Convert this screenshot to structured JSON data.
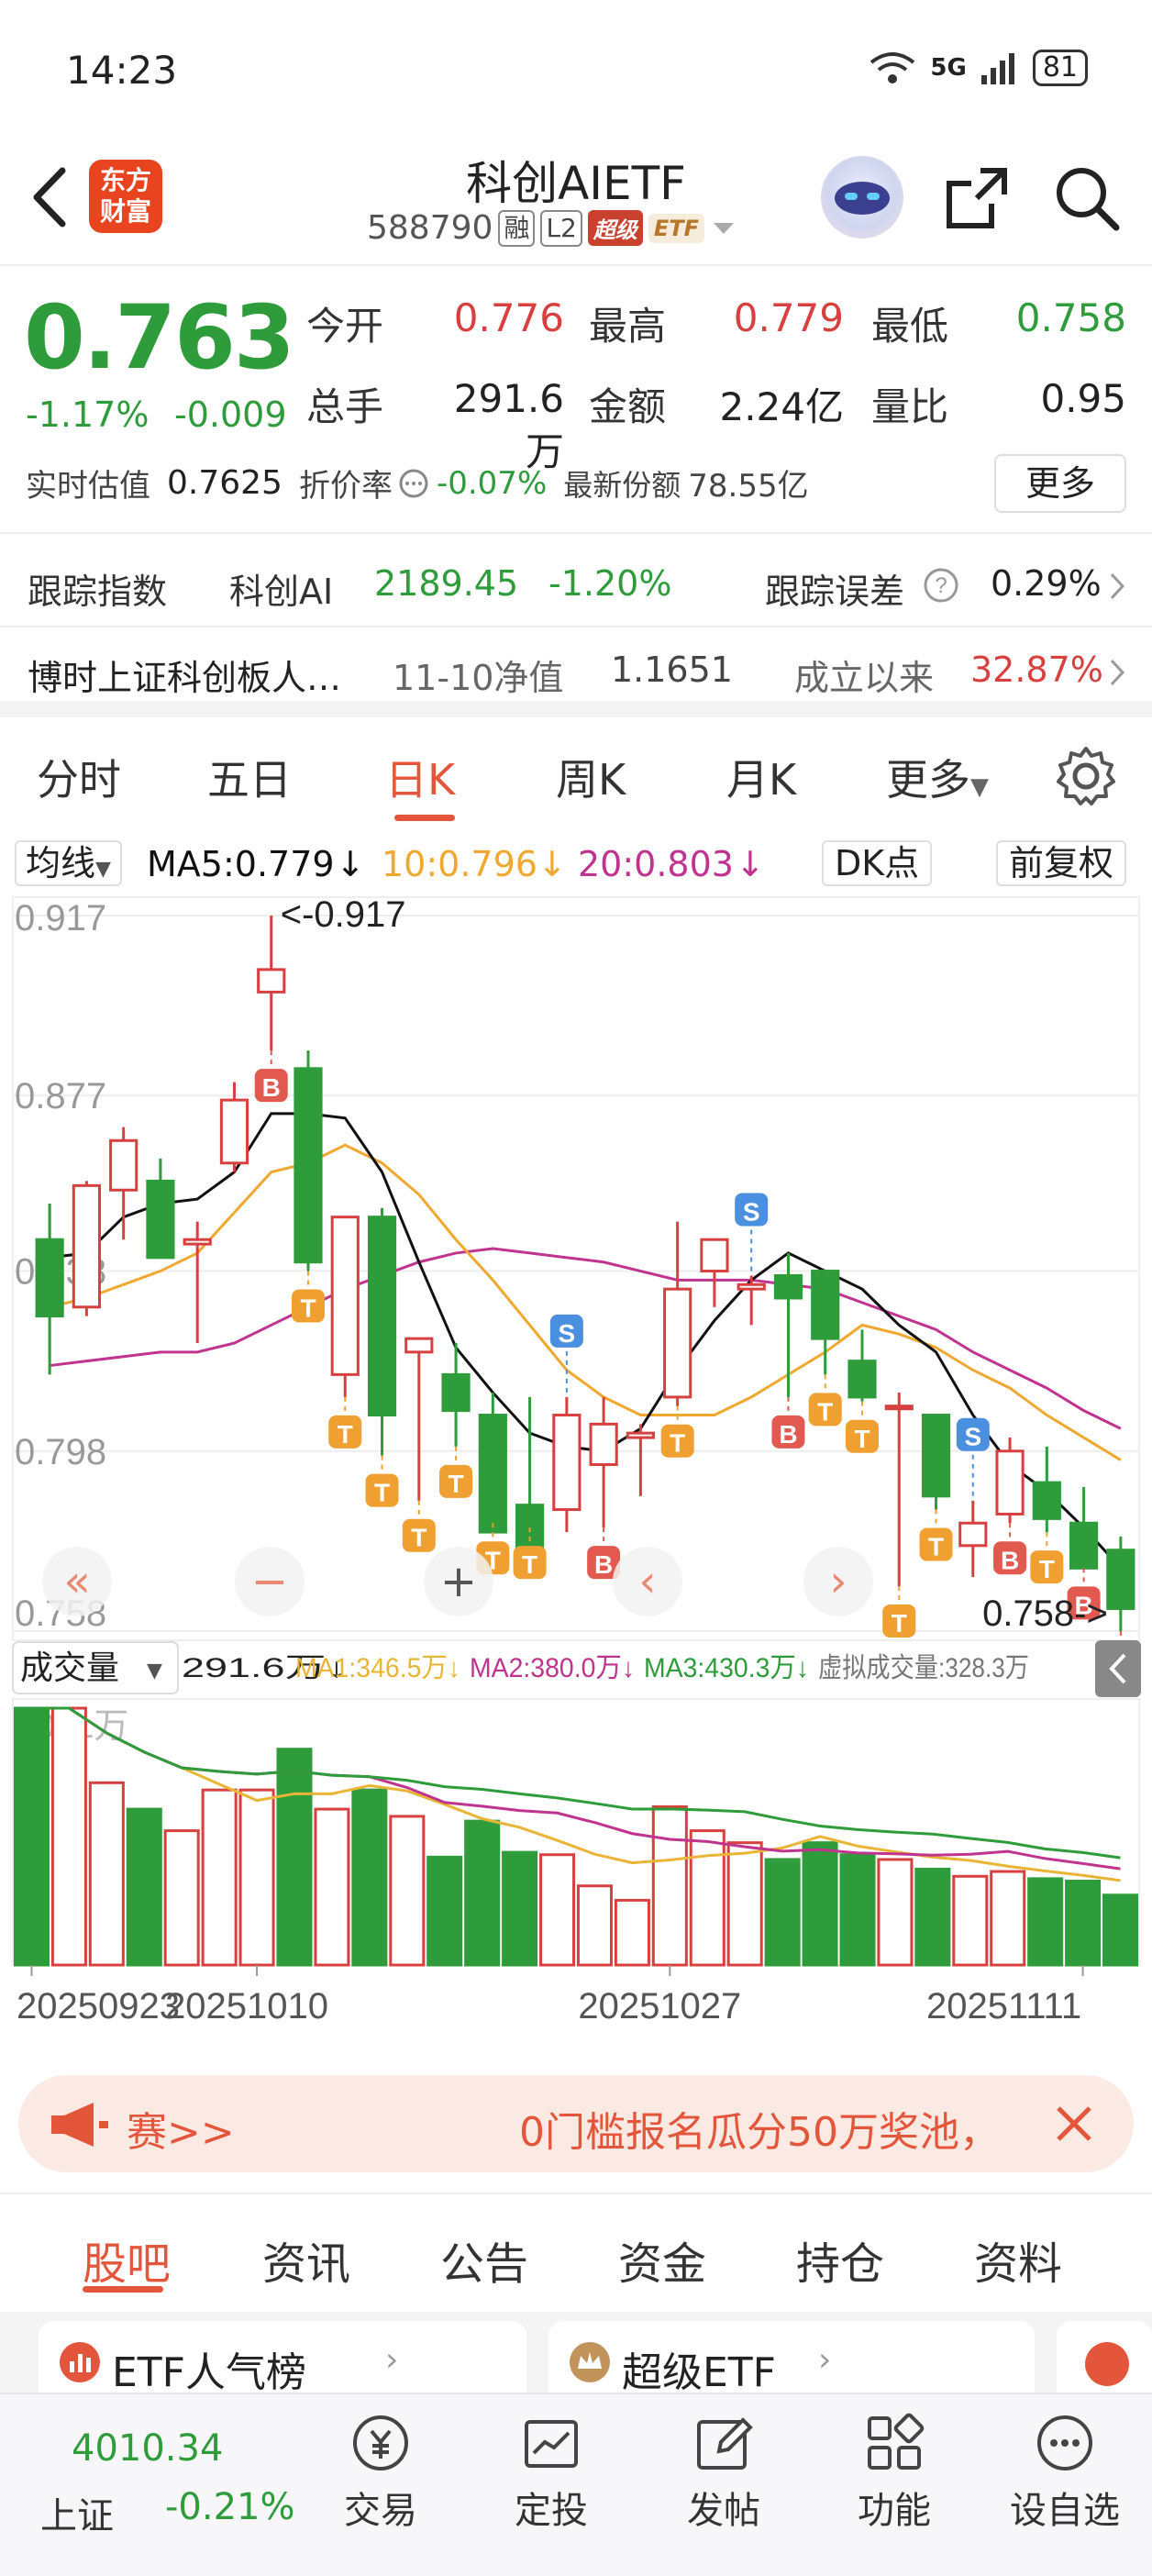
{
  "status": {
    "time": "14:23",
    "network": "5G",
    "battery": "81"
  },
  "header": {
    "title": "科创AIETF",
    "code": "588790",
    "tag_margin": "融",
    "tag_level": "L2",
    "tag_super": "超级",
    "tag_etf": "ETF",
    "logo_line1": "东方",
    "logo_line2": "财富"
  },
  "quote": {
    "price": "0.763",
    "change_pct": "-1.17%",
    "change_val": "-0.009",
    "open_label": "今开",
    "open": "0.776",
    "high_label": "最高",
    "high": "0.779",
    "low_label": "最低",
    "low": "0.758",
    "volume_label": "总手",
    "volume": "291.6万",
    "amount_label": "金额",
    "amount": "2.24亿",
    "ratio_label": "量比",
    "ratio": "0.95",
    "est_label": "实时估值",
    "est": "0.7625",
    "premium_label": "折价率",
    "premium": "-0.07%",
    "shares_label": "最新份额",
    "shares": "78.55亿",
    "more_button": "更多"
  },
  "tracking": {
    "label": "跟踪指数",
    "index_name": "科创AI",
    "index_value": "2189.45",
    "index_change": "-1.20%",
    "error_label": "跟踪误差",
    "error": "0.29%"
  },
  "fund": {
    "name": "博时上证科创板人…",
    "nav_label": "11-10净值",
    "nav": "1.1651",
    "since_label": "成立以来",
    "since": "32.87%"
  },
  "period_tabs": [
    "分时",
    "五日",
    "日K",
    "周K",
    "月K",
    "更多"
  ],
  "ma": {
    "selector": "均线",
    "ma5": "MA5:0.779",
    "ma10": "10:0.796",
    "ma20": "20:0.803",
    "dk": "DK点",
    "adjust": "前复权"
  },
  "colors": {
    "up": "#d8403f",
    "down": "#2e9c3a",
    "ma5": "#111111",
    "ma10": "#f0a830",
    "ma20": "#c0348f",
    "accent": "#e4563b"
  },
  "chart_data": [
    {
      "type": "candlestick",
      "y_axis_ticks": [
        "0.917",
        "0.877",
        "0.838",
        "0.798",
        "0.758"
      ],
      "ylim": [
        0.758,
        0.917
      ],
      "max_marker": "<-0.917",
      "min_marker": "0.758->",
      "candles": [
        {
          "o": 0.845,
          "h": 0.853,
          "l": 0.815,
          "c": 0.828
        },
        {
          "o": 0.83,
          "h": 0.858,
          "l": 0.828,
          "c": 0.857
        },
        {
          "o": 0.856,
          "h": 0.87,
          "l": 0.845,
          "c": 0.867
        },
        {
          "o": 0.858,
          "h": 0.863,
          "l": 0.843,
          "c": 0.841
        },
        {
          "o": 0.844,
          "h": 0.849,
          "l": 0.822,
          "c": 0.845
        },
        {
          "o": 0.862,
          "h": 0.88,
          "l": 0.86,
          "c": 0.876
        },
        {
          "o": 0.9,
          "h": 0.917,
          "l": 0.887,
          "c": 0.905
        },
        {
          "o": 0.883,
          "h": 0.887,
          "l": 0.838,
          "c": 0.84
        },
        {
          "o": 0.815,
          "h": 0.849,
          "l": 0.81,
          "c": 0.85
        },
        {
          "o": 0.85,
          "h": 0.852,
          "l": 0.797,
          "c": 0.806
        },
        {
          "o": 0.82,
          "h": 0.823,
          "l": 0.787,
          "c": 0.823
        },
        {
          "o": 0.815,
          "h": 0.822,
          "l": 0.799,
          "c": 0.807
        },
        {
          "o": 0.806,
          "h": 0.811,
          "l": 0.782,
          "c": 0.78
        },
        {
          "o": 0.786,
          "h": 0.81,
          "l": 0.781,
          "c": 0.776
        },
        {
          "o": 0.785,
          "h": 0.81,
          "l": 0.78,
          "c": 0.806
        },
        {
          "o": 0.795,
          "h": 0.81,
          "l": 0.781,
          "c": 0.804
        },
        {
          "o": 0.801,
          "h": 0.804,
          "l": 0.788,
          "c": 0.802
        },
        {
          "o": 0.81,
          "h": 0.849,
          "l": 0.808,
          "c": 0.834
        },
        {
          "o": 0.838,
          "h": 0.84,
          "l": 0.83,
          "c": 0.845
        },
        {
          "o": 0.834,
          "h": 0.837,
          "l": 0.826,
          "c": 0.835
        },
        {
          "o": 0.837,
          "h": 0.842,
          "l": 0.81,
          "c": 0.832
        },
        {
          "o": 0.838,
          "h": 0.838,
          "l": 0.815,
          "c": 0.823
        },
        {
          "o": 0.818,
          "h": 0.825,
          "l": 0.809,
          "c": 0.81
        },
        {
          "o": 0.808,
          "h": 0.811,
          "l": 0.768,
          "c": 0.808
        },
        {
          "o": 0.806,
          "h": 0.806,
          "l": 0.785,
          "c": 0.788
        },
        {
          "o": 0.777,
          "h": 0.787,
          "l": 0.77,
          "c": 0.782
        },
        {
          "o": 0.784,
          "h": 0.801,
          "l": 0.782,
          "c": 0.798
        },
        {
          "o": 0.791,
          "h": 0.799,
          "l": 0.78,
          "c": 0.783
        },
        {
          "o": 0.782,
          "h": 0.79,
          "l": 0.772,
          "c": 0.772
        },
        {
          "o": 0.776,
          "h": 0.779,
          "l": 0.758,
          "c": 0.763
        }
      ],
      "ma5_line": [
        0.841,
        0.842,
        0.85,
        0.853,
        0.854,
        0.86,
        0.873,
        0.873,
        0.872,
        0.86,
        0.84,
        0.821,
        0.811,
        0.802,
        0.799,
        0.798,
        0.803,
        0.816,
        0.827,
        0.836,
        0.842,
        0.838,
        0.834,
        0.826,
        0.82,
        0.806,
        0.795,
        0.789,
        0.781,
        0.772
      ],
      "ma10_line": [
        0.83,
        0.832,
        0.835,
        0.838,
        0.842,
        0.851,
        0.86,
        0.862,
        0.866,
        0.862,
        0.855,
        0.845,
        0.836,
        0.826,
        0.816,
        0.81,
        0.806,
        0.806,
        0.806,
        0.81,
        0.815,
        0.82,
        0.826,
        0.824,
        0.821,
        0.816,
        0.812,
        0.806,
        0.801,
        0.796
      ],
      "ma20_line": [
        0.817,
        0.818,
        0.819,
        0.82,
        0.82,
        0.822,
        0.826,
        0.83,
        0.834,
        0.837,
        0.84,
        0.842,
        0.843,
        0.842,
        0.841,
        0.84,
        0.838,
        0.836,
        0.836,
        0.836,
        0.835,
        0.834,
        0.831,
        0.828,
        0.825,
        0.82,
        0.816,
        0.812,
        0.807,
        0.803
      ],
      "signals": [
        {
          "i": 6,
          "type": "B"
        },
        {
          "i": 7,
          "type": "T"
        },
        {
          "i": 8,
          "type": "T"
        },
        {
          "i": 9,
          "type": "T"
        },
        {
          "i": 10,
          "type": "T"
        },
        {
          "i": 11,
          "type": "T"
        },
        {
          "i": 12,
          "type": "T"
        },
        {
          "i": 13,
          "type": "T"
        },
        {
          "i": 14,
          "type": "S"
        },
        {
          "i": 15,
          "type": "B"
        },
        {
          "i": 17,
          "type": "T"
        },
        {
          "i": 19,
          "type": "S"
        },
        {
          "i": 20,
          "type": "B"
        },
        {
          "i": 21,
          "type": "T"
        },
        {
          "i": 22,
          "type": "T"
        },
        {
          "i": 23,
          "type": "T"
        },
        {
          "i": 24,
          "type": "T"
        },
        {
          "i": 25,
          "type": "S"
        },
        {
          "i": 26,
          "type": "B"
        },
        {
          "i": 27,
          "type": "T"
        },
        {
          "i": 28,
          "type": "B"
        },
        {
          "i": 29,
          "type": "B"
        }
      ]
    },
    {
      "type": "bar",
      "title": "成交量",
      "current": "291.6万",
      "ma1": "MA1:346.5万",
      "ma2": "MA2:380.0万",
      "ma3": "MA3:430.3万",
      "virtual": "虚拟成交量:328.3万",
      "y_label": "1071万",
      "x_ticks": [
        "20250923",
        "20251010",
        "20251027",
        "20251111"
      ],
      "volumes": [
        1071,
        1071,
        760,
        650,
        560,
        730,
        730,
        900,
        650,
        730,
        620,
        450,
        600,
        470,
        460,
        330,
        270,
        660,
        560,
        510,
        440,
        510,
        460,
        440,
        400,
        370,
        390,
        360,
        350,
        291.6
      ]
    }
  ],
  "chart_controls": {
    "back": "«",
    "minus": "−",
    "plus": "+",
    "prev": "‹",
    "next": "›"
  },
  "banner": {
    "left_text": "赛>>",
    "right_text": "0门槛报名瓜分50万奖池，"
  },
  "content_tabs": [
    "股吧",
    "资讯",
    "公告",
    "资金",
    "持仓",
    "资料"
  ],
  "cards": {
    "left": "ETF人气榜",
    "right": "超级ETF"
  },
  "bottom_nav": {
    "index_value": "4010.34",
    "index_name": "上证",
    "index_change": "-0.21%",
    "items": [
      "交易",
      "定投",
      "发帖",
      "功能",
      "设自选"
    ]
  }
}
